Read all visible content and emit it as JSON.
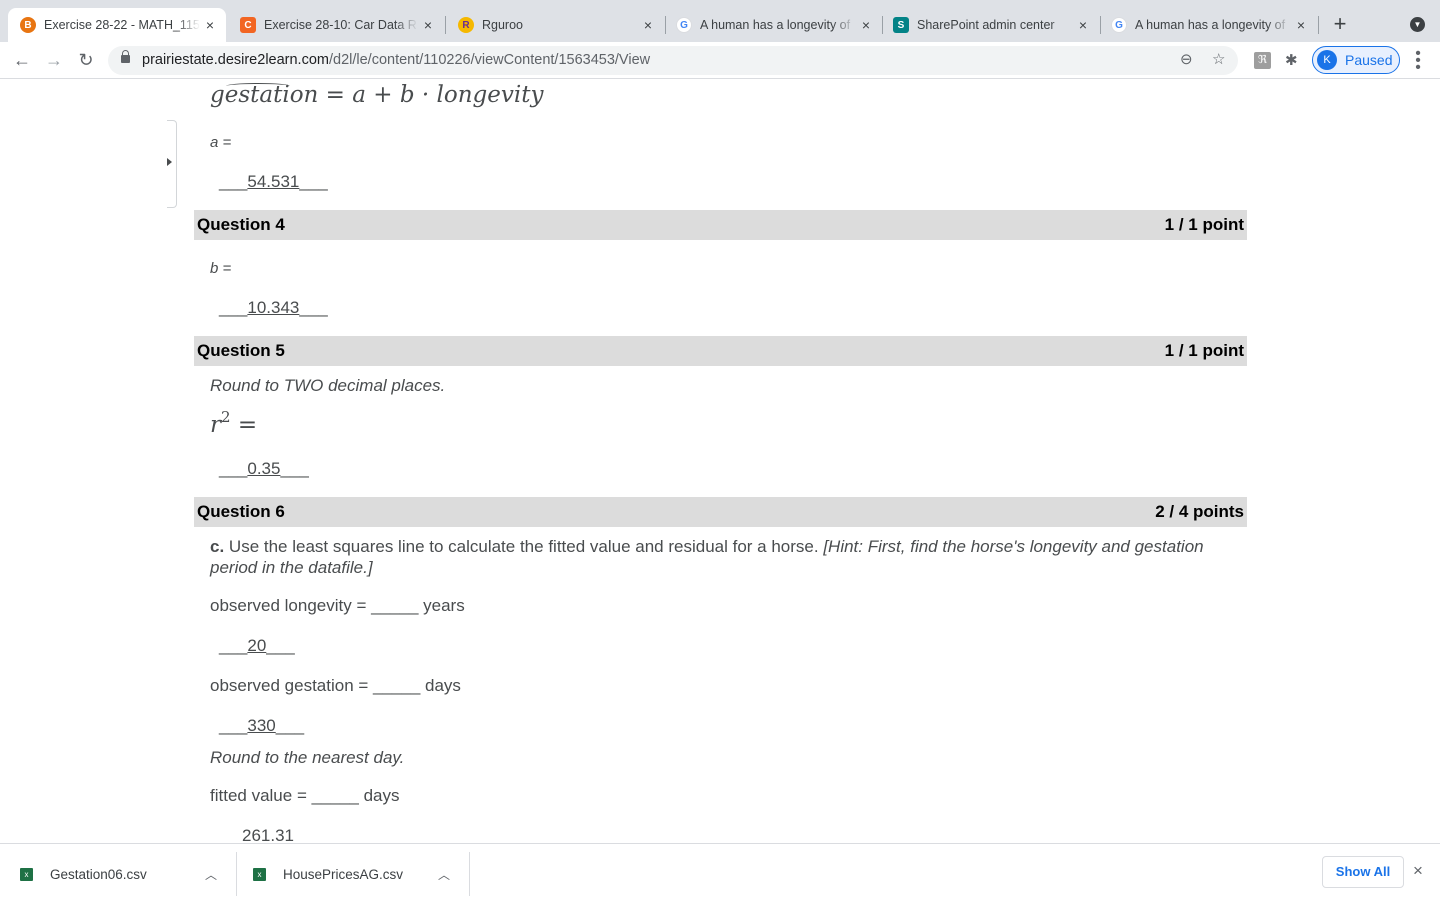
{
  "browser": {
    "tabs": [
      {
        "title": "Exercise 28-22 - MATH_115",
        "favicon": "brightspace-icon",
        "favicon_color": "#e87511",
        "active": true
      },
      {
        "title": "Exercise 28-10: Car Data R",
        "favicon": "c-icon",
        "favicon_color": "#f26522",
        "active": false
      },
      {
        "title": "Rguroo",
        "favicon": "rguroo-icon",
        "favicon_color": "#f5b800",
        "active": false
      },
      {
        "title": "A human has a longevity of",
        "favicon": "google-icon",
        "favicon_color": "#4285f4",
        "active": false
      },
      {
        "title": "SharePoint admin center",
        "favicon": "sharepoint-icon",
        "favicon_color": "#038387",
        "active": false
      },
      {
        "title": "A human has a longevity of",
        "favicon": "google-icon",
        "favicon_color": "#4285f4",
        "active": false
      }
    ],
    "close_glyph": "×",
    "new_tab_glyph": "+",
    "url_host": "prairiestate.desire2learn.com",
    "url_path": "/d2l/le/content/110226/viewContent/1563453/View",
    "profile_initial": "K",
    "profile_status": "Paused",
    "accent_color": "#1a73e8"
  },
  "content": {
    "equation": {
      "lhs": "gestation",
      "rhs": " = a + b · longevity"
    },
    "q3": {
      "label": "a =",
      "answer_prefix": "___",
      "answer": "54.531",
      "answer_suffix": "___"
    },
    "q4": {
      "title": "Question 4",
      "score": "1 / 1 point",
      "label": "b =",
      "answer_prefix": "___",
      "answer": "10.343",
      "answer_suffix": "___"
    },
    "q5": {
      "title": "Question 5",
      "score": "1 / 1 point",
      "instruction": "Round to TWO decimal places.",
      "math_base": "r",
      "math_exp": "2",
      "math_eq": " =",
      "answer_prefix": "___",
      "answer": "0.35",
      "answer_suffix": "___"
    },
    "q6": {
      "title": "Question 6",
      "score": "2 / 4 points",
      "part_label": "c.",
      "prompt": " Use the least squares line to calculate the fitted value and residual for a horse. ",
      "hint": "[Hint: First, find the horse's longevity and gestation period in the datafile.]",
      "longevity_label": "observed longevity = _____ years",
      "longevity_prefix": "___",
      "longevity_answer": "20",
      "longevity_suffix": "___",
      "gestation_label": "observed gestation = _____ days",
      "gestation_prefix": "___",
      "gestation_answer": "330",
      "gestation_suffix": "___",
      "round_instruction": "Round to the nearest day.",
      "fitted_label": "fitted value = _____ days",
      "fitted_answer": "261.31"
    },
    "header_bg": "#dcdcdc"
  },
  "downloads": {
    "items": [
      {
        "name": "Gestation06.csv",
        "icon": "excel-file-icon"
      },
      {
        "name": "HousePricesAG.csv",
        "icon": "excel-file-icon"
      }
    ],
    "show_all_label": "Show All",
    "chevron_glyph": "^",
    "close_glyph": "×"
  }
}
